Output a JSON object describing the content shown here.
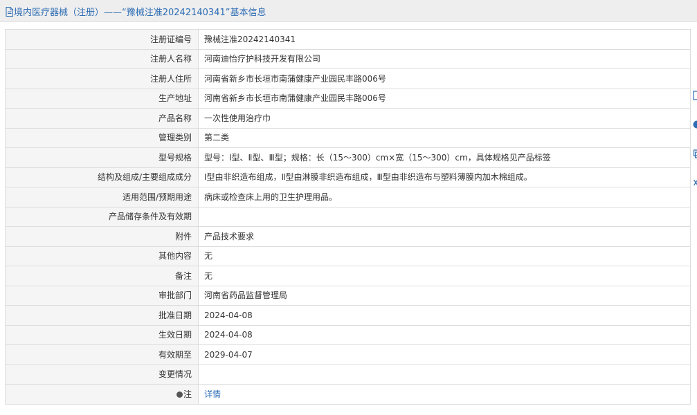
{
  "header": {
    "title": "境内医疗器械（注册）——“豫械注准20242140341”基本信息",
    "icon": "document-icon",
    "accent_color": "#2e6db4"
  },
  "rows": [
    {
      "key": "registration-number",
      "label": "注册证编号",
      "value": "豫械注准20242140341"
    },
    {
      "key": "registrant-name",
      "label": "注册人名称",
      "value": "河南迪怡疗护科技开发有限公司"
    },
    {
      "key": "registrant-address",
      "label": "注册人住所",
      "value": "河南省新乡市长垣市南蒲健康产业园民丰路006号"
    },
    {
      "key": "production-address",
      "label": "生产地址",
      "value": "河南省新乡市长垣市南蒲健康产业园民丰路006号"
    },
    {
      "key": "product-name",
      "label": "产品名称",
      "value": "一次性使用治疗巾"
    },
    {
      "key": "management-category",
      "label": "管理类别",
      "value": "第二类"
    },
    {
      "key": "model-specification",
      "label": "型号规格",
      "value": "型号：Ⅰ型、Ⅱ型、Ⅲ型；规格：长（15～300）cm×宽（15～300）cm，具体规格见产品标签"
    },
    {
      "key": "structure-composition",
      "label": "结构及组成/主要组成成分",
      "value": "Ⅰ型由非织造布组成，Ⅱ型由淋膜非织造布组成，Ⅲ型由非织造布与塑料薄膜内加木棉组成。"
    },
    {
      "key": "scope-of-application",
      "label": "适用范围/预期用途",
      "value": "病床或检查床上用的卫生护理用品。"
    },
    {
      "key": "storage-conditions",
      "label": "产品储存条件及有效期",
      "value": ""
    },
    {
      "key": "attachment",
      "label": "附件",
      "value": "产品技术要求"
    },
    {
      "key": "other-content",
      "label": "其他内容",
      "value": "无"
    },
    {
      "key": "remarks",
      "label": "备注",
      "value": "无"
    },
    {
      "key": "approval-department",
      "label": "审批部门",
      "value": "河南省药品监督管理局"
    },
    {
      "key": "approval-date",
      "label": "批准日期",
      "value": "2024-04-08"
    },
    {
      "key": "effective-date",
      "label": "生效日期",
      "value": "2024-04-08"
    },
    {
      "key": "expiry-date",
      "label": "有效期至",
      "value": "2029-04-07"
    },
    {
      "key": "change-history",
      "label": "变更情况",
      "value": ""
    }
  ],
  "note_row": {
    "label": "注",
    "link_text": "详情",
    "icon": "info-dot-icon"
  },
  "side_tools": [
    "document-tool-icon",
    "info-tool-icon",
    "copy-tool-icon",
    "close-tool-icon"
  ]
}
